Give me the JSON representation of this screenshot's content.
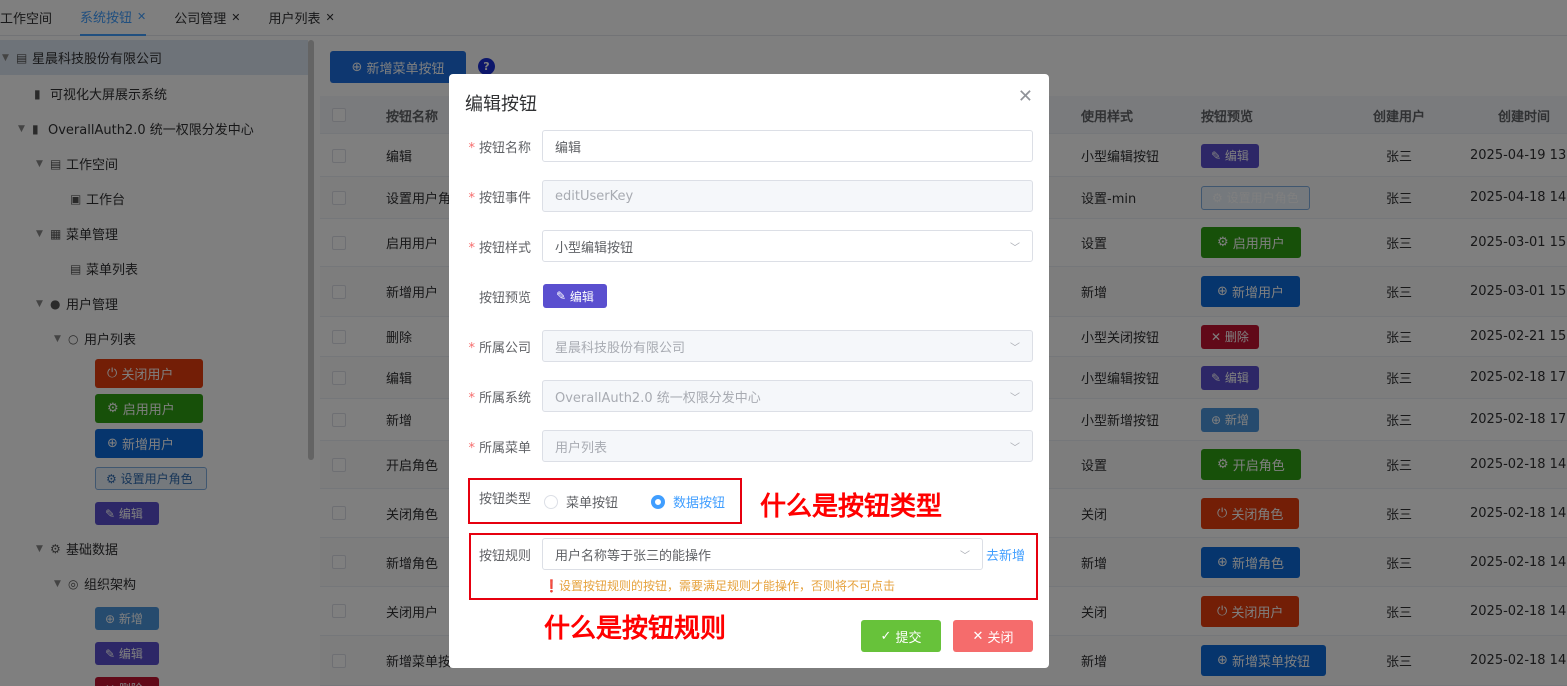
{
  "tabs": [
    {
      "label": "工作空间",
      "active": false,
      "closable": false
    },
    {
      "label": "系统按钮",
      "active": true,
      "closable": true
    },
    {
      "label": "公司管理",
      "active": false,
      "closable": true
    },
    {
      "label": "用户列表",
      "active": false,
      "closable": true
    }
  ],
  "sidebar": {
    "root": "星晨科技股份有限公司",
    "nodes": {
      "bigscreen": "可视化大屏展示系统",
      "auth": "OverallAuth2.0 统一权限分发中心",
      "workspace": "工作空间",
      "workbench": "工作台",
      "menu_mgmt": "菜单管理",
      "menu_list": "菜单列表",
      "user_mgmt": "用户管理",
      "user_list": "用户列表",
      "basic_data": "基础数据",
      "org": "组织架构"
    },
    "buttons": {
      "close_user": "关闭用户",
      "enable_user": "启用用户",
      "add_user": "新增用户",
      "set_role": "设置用户角色",
      "edit": "编辑",
      "org_add": "新增",
      "org_edit": "编辑",
      "org_delete": "删除"
    }
  },
  "toolbar": {
    "add_menu_button": "新增菜单按钮",
    "help": "?"
  },
  "table": {
    "headers": {
      "name": "按钮名称",
      "style": "使用样式",
      "preview": "按钮预览",
      "creator": "创建用户",
      "created": "创建时间"
    },
    "rows": [
      {
        "name": "编辑",
        "style": "小型编辑按钮",
        "preview": "编辑",
        "creator": "张三",
        "created": "2025-04-19 13:"
      },
      {
        "name": "设置用户角色",
        "style": "设置-min",
        "preview": "设置用户角色",
        "creator": "张三",
        "created": "2025-04-18 14:"
      },
      {
        "name": "启用用户",
        "style": "设置",
        "preview": "启用用户",
        "creator": "张三",
        "created": "2025-03-01 15:"
      },
      {
        "name": "新增用户",
        "style": "新增",
        "preview": "新增用户",
        "creator": "张三",
        "created": "2025-03-01 15:"
      },
      {
        "name": "删除",
        "style": "小型关闭按钮",
        "preview": "删除",
        "creator": "张三",
        "created": "2025-02-21 15:"
      },
      {
        "name": "编辑",
        "style": "小型编辑按钮",
        "preview": "编辑",
        "creator": "张三",
        "created": "2025-02-18 17:"
      },
      {
        "name": "新增",
        "style": "小型新增按钮",
        "preview": "新增",
        "creator": "张三",
        "created": "2025-02-18 17:"
      },
      {
        "name": "开启角色",
        "style": "设置",
        "preview": "开启角色",
        "creator": "张三",
        "created": "2025-02-18 14:"
      },
      {
        "name": "关闭角色",
        "style": "关闭",
        "preview": "关闭角色",
        "creator": "张三",
        "created": "2025-02-18 14:"
      },
      {
        "name": "新增角色",
        "style": "新增",
        "preview": "新增角色",
        "creator": "张三",
        "created": "2025-02-18 14:"
      },
      {
        "name": "关闭用户",
        "style": "关闭",
        "preview": "关闭用户",
        "creator": "张三",
        "created": "2025-02-18 14:"
      },
      {
        "name": "新增菜单按钮",
        "style": "新增",
        "preview": "新增菜单按钮",
        "creator": "张三",
        "created": "2025-02-18 14:"
      }
    ]
  },
  "dialog": {
    "title": "编辑按钮",
    "fields": {
      "name": {
        "label": "按钮名称",
        "value": "编辑"
      },
      "event": {
        "label": "按钮事件",
        "value": "editUserKey"
      },
      "style": {
        "label": "按钮样式",
        "value": "小型编辑按钮"
      },
      "preview": {
        "label": "按钮预览",
        "value": "编辑"
      },
      "company": {
        "label": "所属公司",
        "value": "星晨科技股份有限公司"
      },
      "system": {
        "label": "所属系统",
        "value": "OverallAuth2.0 统一权限分发中心"
      },
      "menu": {
        "label": "所属菜单",
        "value": "用户列表"
      },
      "type": {
        "label": "按钮类型",
        "options": [
          "菜单按钮",
          "数据按钮"
        ],
        "selected": "数据按钮"
      },
      "rule": {
        "label": "按钮规则",
        "value": "用户名称等于张三的能操作",
        "add_link": "去新增",
        "hint": "设置按钮规则的按钮，需要满足规则才能操作，否则将不可点击"
      }
    },
    "submit": "提交",
    "close": "关闭"
  },
  "annotations": {
    "type": "什么是按钮类型",
    "rule": "什么是按钮规则"
  },
  "colors": {
    "primary": "#409eff",
    "annotation": "#e6000f",
    "submit": "#67c23a",
    "close": "#f56c6c"
  }
}
